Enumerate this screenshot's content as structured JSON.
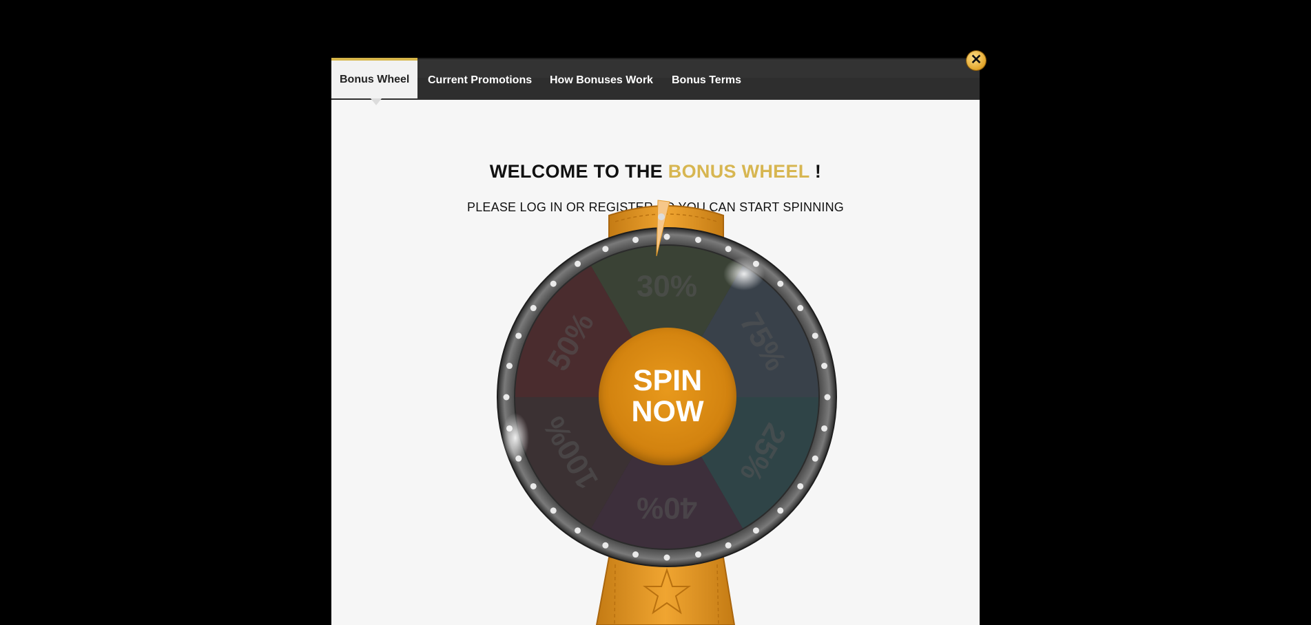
{
  "tabs": [
    {
      "label": "Bonus Wheel",
      "active": true
    },
    {
      "label": "Current Promotions",
      "active": false
    },
    {
      "label": "How Bonuses Work",
      "active": false
    },
    {
      "label": "Bonus Terms",
      "active": false
    }
  ],
  "welcome": {
    "prefix": "WELCOME TO THE",
    "highlight": "BONUS WHEEL",
    "suffix": "!"
  },
  "subtitle": "PLEASE LOG IN OR REGISTER SO YOU CAN START SPINNING",
  "close": {
    "icon": "close-icon",
    "symbol": "✕"
  },
  "wheel": {
    "segments": [
      {
        "label": "30%",
        "color": "#3a4235"
      },
      {
        "label": "75%",
        "color": "#39414a"
      },
      {
        "label": "25%",
        "color": "#2f4447"
      },
      {
        "label": "40%",
        "color": "#3d2f3b"
      },
      {
        "label": "100%",
        "color": "#3b3133"
      },
      {
        "label": "50%",
        "color": "#4a2c2e"
      }
    ],
    "button": {
      "line1": "SPIN",
      "line2": "NOW"
    }
  },
  "colors": {
    "accent": "#d7b651",
    "stand": "#e39a2a",
    "spin": "#cf7f0d"
  }
}
